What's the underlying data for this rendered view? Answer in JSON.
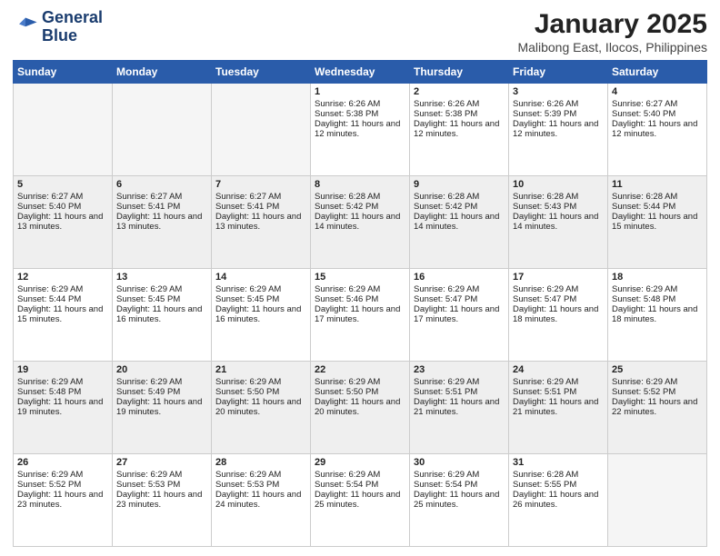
{
  "logo": {
    "line1": "General",
    "line2": "Blue"
  },
  "title": "January 2025",
  "subtitle": "Malibong East, Ilocos, Philippines",
  "weekdays": [
    "Sunday",
    "Monday",
    "Tuesday",
    "Wednesday",
    "Thursday",
    "Friday",
    "Saturday"
  ],
  "weeks": [
    [
      {
        "day": "",
        "empty": true
      },
      {
        "day": "",
        "empty": true
      },
      {
        "day": "",
        "empty": true
      },
      {
        "day": "1",
        "sunrise": "6:26 AM",
        "sunset": "5:38 PM",
        "daylight": "11 hours and 12 minutes."
      },
      {
        "day": "2",
        "sunrise": "6:26 AM",
        "sunset": "5:38 PM",
        "daylight": "11 hours and 12 minutes."
      },
      {
        "day": "3",
        "sunrise": "6:26 AM",
        "sunset": "5:39 PM",
        "daylight": "11 hours and 12 minutes."
      },
      {
        "day": "4",
        "sunrise": "6:27 AM",
        "sunset": "5:40 PM",
        "daylight": "11 hours and 12 minutes."
      }
    ],
    [
      {
        "day": "5",
        "sunrise": "6:27 AM",
        "sunset": "5:40 PM",
        "daylight": "11 hours and 13 minutes."
      },
      {
        "day": "6",
        "sunrise": "6:27 AM",
        "sunset": "5:41 PM",
        "daylight": "11 hours and 13 minutes."
      },
      {
        "day": "7",
        "sunrise": "6:27 AM",
        "sunset": "5:41 PM",
        "daylight": "11 hours and 13 minutes."
      },
      {
        "day": "8",
        "sunrise": "6:28 AM",
        "sunset": "5:42 PM",
        "daylight": "11 hours and 14 minutes."
      },
      {
        "day": "9",
        "sunrise": "6:28 AM",
        "sunset": "5:42 PM",
        "daylight": "11 hours and 14 minutes."
      },
      {
        "day": "10",
        "sunrise": "6:28 AM",
        "sunset": "5:43 PM",
        "daylight": "11 hours and 14 minutes."
      },
      {
        "day": "11",
        "sunrise": "6:28 AM",
        "sunset": "5:44 PM",
        "daylight": "11 hours and 15 minutes."
      }
    ],
    [
      {
        "day": "12",
        "sunrise": "6:29 AM",
        "sunset": "5:44 PM",
        "daylight": "11 hours and 15 minutes."
      },
      {
        "day": "13",
        "sunrise": "6:29 AM",
        "sunset": "5:45 PM",
        "daylight": "11 hours and 16 minutes."
      },
      {
        "day": "14",
        "sunrise": "6:29 AM",
        "sunset": "5:45 PM",
        "daylight": "11 hours and 16 minutes."
      },
      {
        "day": "15",
        "sunrise": "6:29 AM",
        "sunset": "5:46 PM",
        "daylight": "11 hours and 17 minutes."
      },
      {
        "day": "16",
        "sunrise": "6:29 AM",
        "sunset": "5:47 PM",
        "daylight": "11 hours and 17 minutes."
      },
      {
        "day": "17",
        "sunrise": "6:29 AM",
        "sunset": "5:47 PM",
        "daylight": "11 hours and 18 minutes."
      },
      {
        "day": "18",
        "sunrise": "6:29 AM",
        "sunset": "5:48 PM",
        "daylight": "11 hours and 18 minutes."
      }
    ],
    [
      {
        "day": "19",
        "sunrise": "6:29 AM",
        "sunset": "5:48 PM",
        "daylight": "11 hours and 19 minutes."
      },
      {
        "day": "20",
        "sunrise": "6:29 AM",
        "sunset": "5:49 PM",
        "daylight": "11 hours and 19 minutes."
      },
      {
        "day": "21",
        "sunrise": "6:29 AM",
        "sunset": "5:50 PM",
        "daylight": "11 hours and 20 minutes."
      },
      {
        "day": "22",
        "sunrise": "6:29 AM",
        "sunset": "5:50 PM",
        "daylight": "11 hours and 20 minutes."
      },
      {
        "day": "23",
        "sunrise": "6:29 AM",
        "sunset": "5:51 PM",
        "daylight": "11 hours and 21 minutes."
      },
      {
        "day": "24",
        "sunrise": "6:29 AM",
        "sunset": "5:51 PM",
        "daylight": "11 hours and 21 minutes."
      },
      {
        "day": "25",
        "sunrise": "6:29 AM",
        "sunset": "5:52 PM",
        "daylight": "11 hours and 22 minutes."
      }
    ],
    [
      {
        "day": "26",
        "sunrise": "6:29 AM",
        "sunset": "5:52 PM",
        "daylight": "11 hours and 23 minutes."
      },
      {
        "day": "27",
        "sunrise": "6:29 AM",
        "sunset": "5:53 PM",
        "daylight": "11 hours and 23 minutes."
      },
      {
        "day": "28",
        "sunrise": "6:29 AM",
        "sunset": "5:53 PM",
        "daylight": "11 hours and 24 minutes."
      },
      {
        "day": "29",
        "sunrise": "6:29 AM",
        "sunset": "5:54 PM",
        "daylight": "11 hours and 25 minutes."
      },
      {
        "day": "30",
        "sunrise": "6:29 AM",
        "sunset": "5:54 PM",
        "daylight": "11 hours and 25 minutes."
      },
      {
        "day": "31",
        "sunrise": "6:28 AM",
        "sunset": "5:55 PM",
        "daylight": "11 hours and 26 minutes."
      },
      {
        "day": "",
        "empty": true
      }
    ]
  ],
  "labels": {
    "sunrise": "Sunrise:",
    "sunset": "Sunset:",
    "daylight": "Daylight:"
  }
}
